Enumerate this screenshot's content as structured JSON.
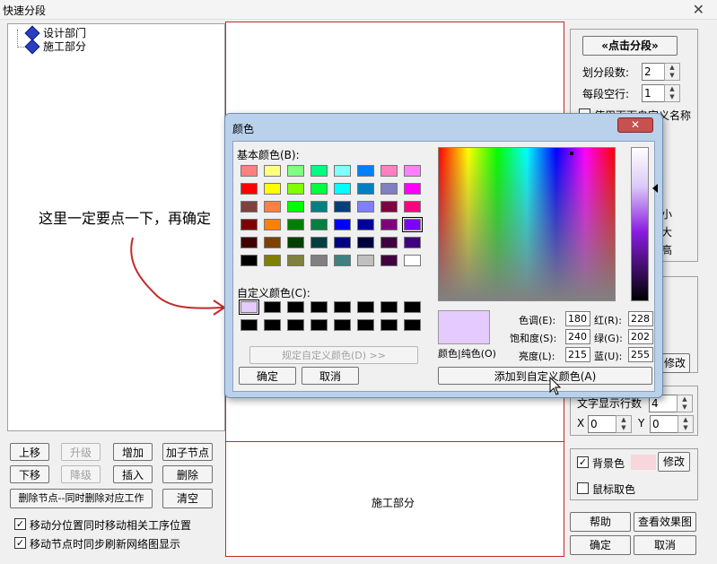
{
  "window": {
    "title": "快速分段",
    "close_glyph": "✕"
  },
  "tree": {
    "items": [
      "设计部门",
      "施工部分"
    ]
  },
  "annotation": {
    "text": "这里一定要点一下，再确定",
    "color": "#c42a2a"
  },
  "left_buttons": {
    "up": "上移",
    "promote": "升级",
    "add": "增加",
    "add_child": "加子节点",
    "down": "下移",
    "demote": "降级",
    "insert": "插入",
    "delete": "删除",
    "delete_sync": "删除节点--同时删除对应工作",
    "clear": "清空"
  },
  "left_checks": {
    "move_sync": "移动分位置同时移动相关工序位置",
    "refresh_sync": "移动节点时同步刷新网络图显示"
  },
  "center": {
    "bottom_label": "施工部分"
  },
  "right": {
    "click_segment": "«点击分段»",
    "segments_label": "划分段数:",
    "segments_value": "2",
    "blank_rows_label": "每段空行:",
    "blank_rows_value": "1",
    "use_custom_name": "使用下面自定义名称",
    "modify_1": "修改",
    "text_rows_label": "文字显示行数",
    "text_rows_value": "4",
    "x_label": "X",
    "x_value": "0",
    "y_label": "Y",
    "y_value": "0",
    "bg_color_label": "背景色",
    "bg_color": "#f7d6dc",
    "modify_2": "修改",
    "mouse_pick": "鼠标取色",
    "help": "帮助",
    "preview": "查看效果图",
    "ok": "确定",
    "cancel": "取消",
    "partial_chars": [
      "小",
      "大",
      "高"
    ]
  },
  "color_dialog": {
    "title": "颜色",
    "basic_label": "基本颜色(B):",
    "custom_label": "自定义颜色(C):",
    "define_custom": "规定自定义颜色(D) >>",
    "ok": "确定",
    "cancel": "取消",
    "color_solid_label": "颜色|纯色(O)",
    "hue_label": "色调(E):",
    "hue": "180",
    "sat_label": "饱和度(S):",
    "sat": "240",
    "lum_label": "亮度(L):",
    "lum": "215",
    "red_label": "红(R):",
    "red": "228",
    "green_label": "绿(G):",
    "green": "202",
    "blue_label": "蓝(U):",
    "blue": "255",
    "add_custom": "添加到自定义颜色(A)",
    "preview_color": "#e4caff",
    "basic_colors": [
      "#ff8080",
      "#ffff80",
      "#80ff80",
      "#00ff80",
      "#80ffff",
      "#0080ff",
      "#ff80c0",
      "#ff80ff",
      "#ff0000",
      "#ffff00",
      "#80ff00",
      "#00ff40",
      "#00ffff",
      "#0080c0",
      "#8080c0",
      "#ff00ff",
      "#804040",
      "#ff8040",
      "#00ff00",
      "#008080",
      "#004080",
      "#8080ff",
      "#800040",
      "#ff0080",
      "#800000",
      "#ff8000",
      "#008000",
      "#008040",
      "#0000ff",
      "#0000a0",
      "#800080",
      "#8000ff",
      "#400000",
      "#804000",
      "#004000",
      "#004040",
      "#000080",
      "#000040",
      "#400040",
      "#400080",
      "#000000",
      "#808000",
      "#808040",
      "#808080",
      "#408080",
      "#c0c0c0",
      "#400040",
      "#ffffff"
    ],
    "custom_colors": [
      "#e4caff",
      "#000000",
      "#000000",
      "#000000",
      "#000000",
      "#000000",
      "#000000",
      "#000000",
      "#000000",
      "#000000",
      "#000000",
      "#000000",
      "#000000",
      "#000000",
      "#000000",
      "#000000"
    ]
  }
}
